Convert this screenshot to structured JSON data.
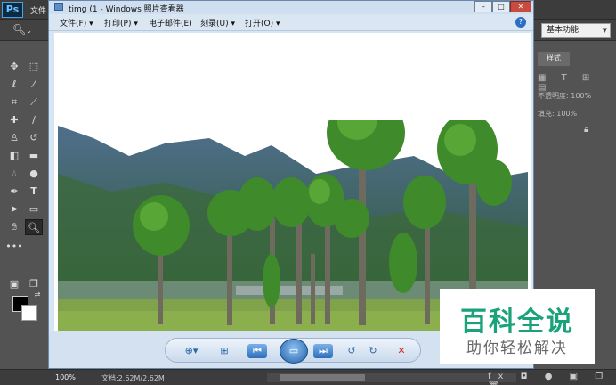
{
  "photoshop": {
    "logo": "Ps",
    "menu_partial": "文件",
    "workspace": "基本功能",
    "layers_tab": "样式",
    "opacity_label": "不透明度: 100%",
    "fill_label": "填充: 100%",
    "status_zoom": "100%",
    "status_doc": "文档:2.62M/2.62M",
    "tool_icons": [
      "move-icon",
      "marquee-icon",
      "lasso-icon",
      "magic-wand-icon",
      "crop-icon",
      "eyedropper-icon",
      "healing-icon",
      "brush-icon",
      "stamp-icon",
      "history-brush-icon",
      "eraser-icon",
      "gradient-icon",
      "blur-icon",
      "dodge-icon",
      "pen-icon",
      "type-icon",
      "path-select-icon",
      "shape-icon",
      "hand-icon",
      "zoom-icon"
    ]
  },
  "viewer": {
    "title": "timg (1 - Windows 照片查看器",
    "window_buttons": {
      "minimize": "–",
      "maximize": "□",
      "close": "✕"
    },
    "menu": {
      "file": "文件(F)",
      "print": "打印(P)",
      "email": "电子邮件(E)",
      "burn": "刻录(U)",
      "open": "打开(O)"
    },
    "help": "?"
  },
  "watermark": {
    "title": "百科全说",
    "subtitle": "助你轻松解决"
  },
  "colors": {
    "ps_bg": "#535353",
    "viewer_bg": "#d7e4f2",
    "watermark_green": "#1aa37a",
    "delete_red": "#d42c1e"
  }
}
